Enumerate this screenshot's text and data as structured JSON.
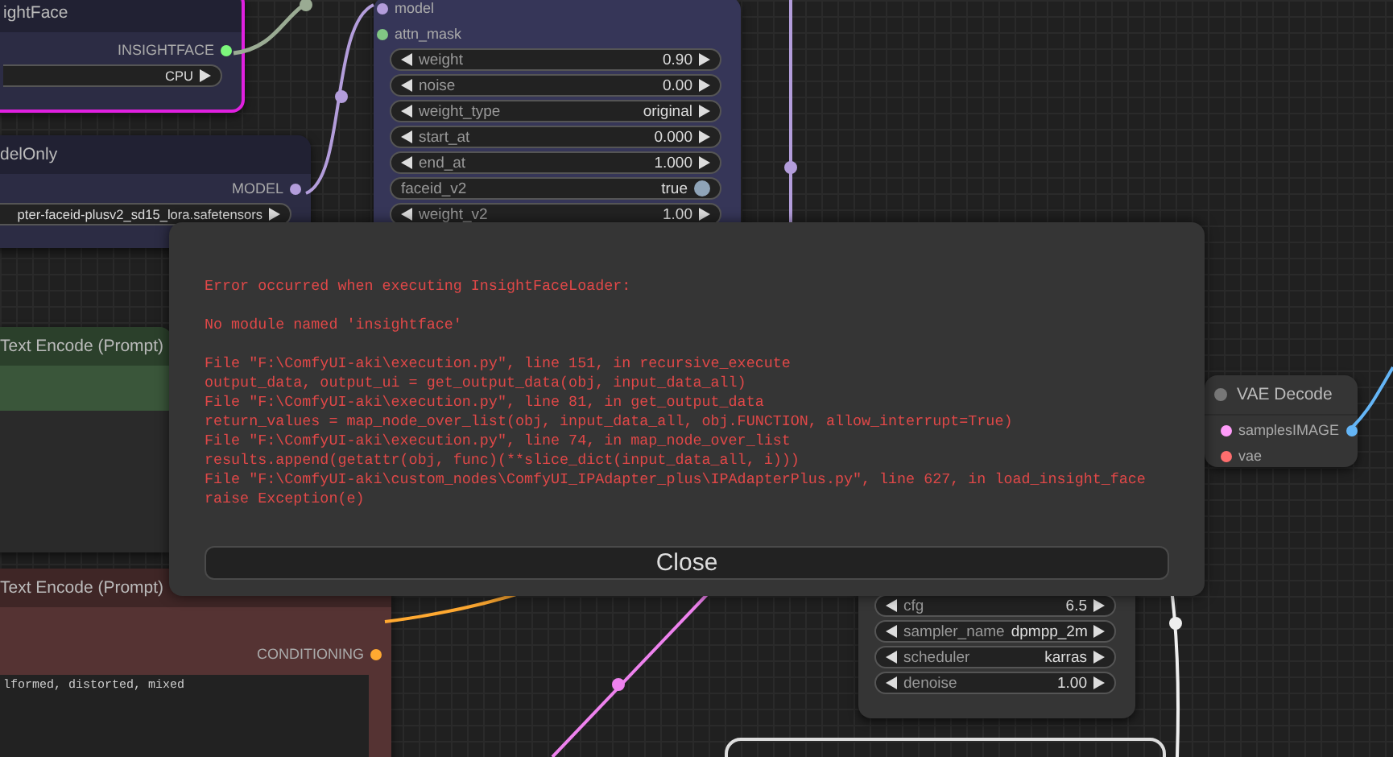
{
  "nodes": [
    {
      "title": "ightFace",
      "color": "#2c2c44",
      "error": true,
      "outputs": [
        {
          "name": "INSIGHTFACE",
          "color": "#7cf77c"
        }
      ],
      "widgets": [
        {
          "kind": "combo",
          "value": "CPU"
        }
      ]
    },
    {
      "title": "delOnly",
      "color": "#2c2c44",
      "error": false,
      "outputs": [
        {
          "name": "MODEL",
          "color": "#b39ddb"
        }
      ],
      "widgets": [
        {
          "kind": "combo",
          "value": "pter-faceid-plusv2_sd15_lora.safetensors"
        }
      ]
    },
    {
      "color": "#363658",
      "error": false,
      "inputs": [
        {
          "name": "model",
          "color": "#b39ddb"
        },
        {
          "name": "attn_mask",
          "color": "#81c784"
        }
      ],
      "widgets": [
        {
          "kind": "number",
          "name": "weight",
          "value": "0.90"
        },
        {
          "kind": "number",
          "name": "noise",
          "value": "0.00"
        },
        {
          "kind": "combo",
          "name": "weight_type",
          "value": "original"
        },
        {
          "kind": "number",
          "name": "start_at",
          "value": "0.000"
        },
        {
          "kind": "number",
          "name": "end_at",
          "value": "1.000"
        },
        {
          "kind": "toggle",
          "name": "faceid_v2",
          "value": "true",
          "on": true
        },
        {
          "kind": "number",
          "name": "weight_v2",
          "value": "1.00"
        }
      ]
    },
    {
      "title": "Text Encode (Prompt)",
      "color": "#3a563a",
      "error": false
    },
    {
      "title": "Text Encode (Prompt)",
      "color": "#553333",
      "error": false,
      "outputs": [
        {
          "name": "CONDITIONING",
          "color": "#ffa931"
        }
      ],
      "widgets": [
        {
          "kind": "text",
          "value": "lformed, distorted, mixed"
        }
      ]
    },
    {
      "color": "#353535",
      "error": false,
      "widgets": [
        {
          "kind": "number",
          "name": "cfg",
          "value": "6.5"
        },
        {
          "kind": "combo",
          "name": "sampler_name",
          "value": "dpmpp_2m"
        },
        {
          "kind": "combo",
          "name": "scheduler",
          "value": "karras"
        },
        {
          "kind": "number",
          "name": "denoise",
          "value": "1.00"
        }
      ]
    },
    {
      "title": "VAE Decode",
      "color": "#353535",
      "error": false,
      "inputs": [
        {
          "name": "samples",
          "color": "#ff9cf9"
        },
        {
          "name": "vae",
          "color": "#ff6e6e"
        }
      ],
      "outputs": [
        {
          "name": "IMAGE",
          "color": "#64b5f6"
        }
      ]
    }
  ],
  "dialog": {
    "paragraphs": [
      [
        "Error occurred when executing InsightFaceLoader:"
      ],
      [
        "No module named 'insightface'"
      ],
      [
        "File \"F:\\ComfyUI-aki\\execution.py\", line 151, in recursive_execute",
        "output_data, output_ui = get_output_data(obj, input_data_all)",
        "File \"F:\\ComfyUI-aki\\execution.py\", line 81, in get_output_data",
        "return_values = map_node_over_list(obj, input_data_all, obj.FUNCTION, allow_interrupt=True)",
        "File \"F:\\ComfyUI-aki\\execution.py\", line 74, in map_node_over_list",
        "results.append(getattr(obj, func)(**slice_dict(input_data_all, i)))",
        "File \"F:\\ComfyUI-aki\\custom_nodes\\ComfyUI_IPAdapter_plus\\IPAdapterPlus.py\", line 627, in load_insight_face",
        "raise Exception(e)"
      ]
    ],
    "button": "Close"
  }
}
